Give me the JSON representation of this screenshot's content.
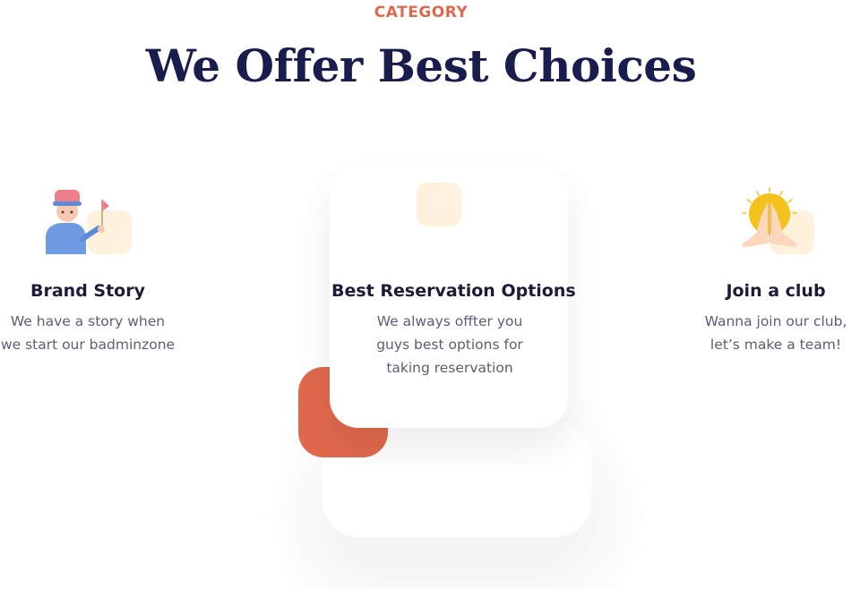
{
  "section": {
    "eyebrow": "CATEGORY",
    "title": "We Offer Best Choices"
  },
  "features": [
    {
      "title": "Brand Story",
      "text": "We have a story when we start our badminzone",
      "icon": "player-with-flag-icon"
    },
    {
      "title": "Best Reservation Options",
      "text": "We always offter you guys best options for taking reservation",
      "icon": "blank-tile-icon"
    },
    {
      "title": "Join a club",
      "text": "Wanna join our club, let’s make a team!",
      "icon": "praying-hands-icon"
    }
  ],
  "colors": {
    "accent": "#e0694d",
    "title": "#181d4e",
    "heading": "#1e1b3a",
    "body_text": "#5b5e77",
    "blob": "#fff1dc"
  }
}
